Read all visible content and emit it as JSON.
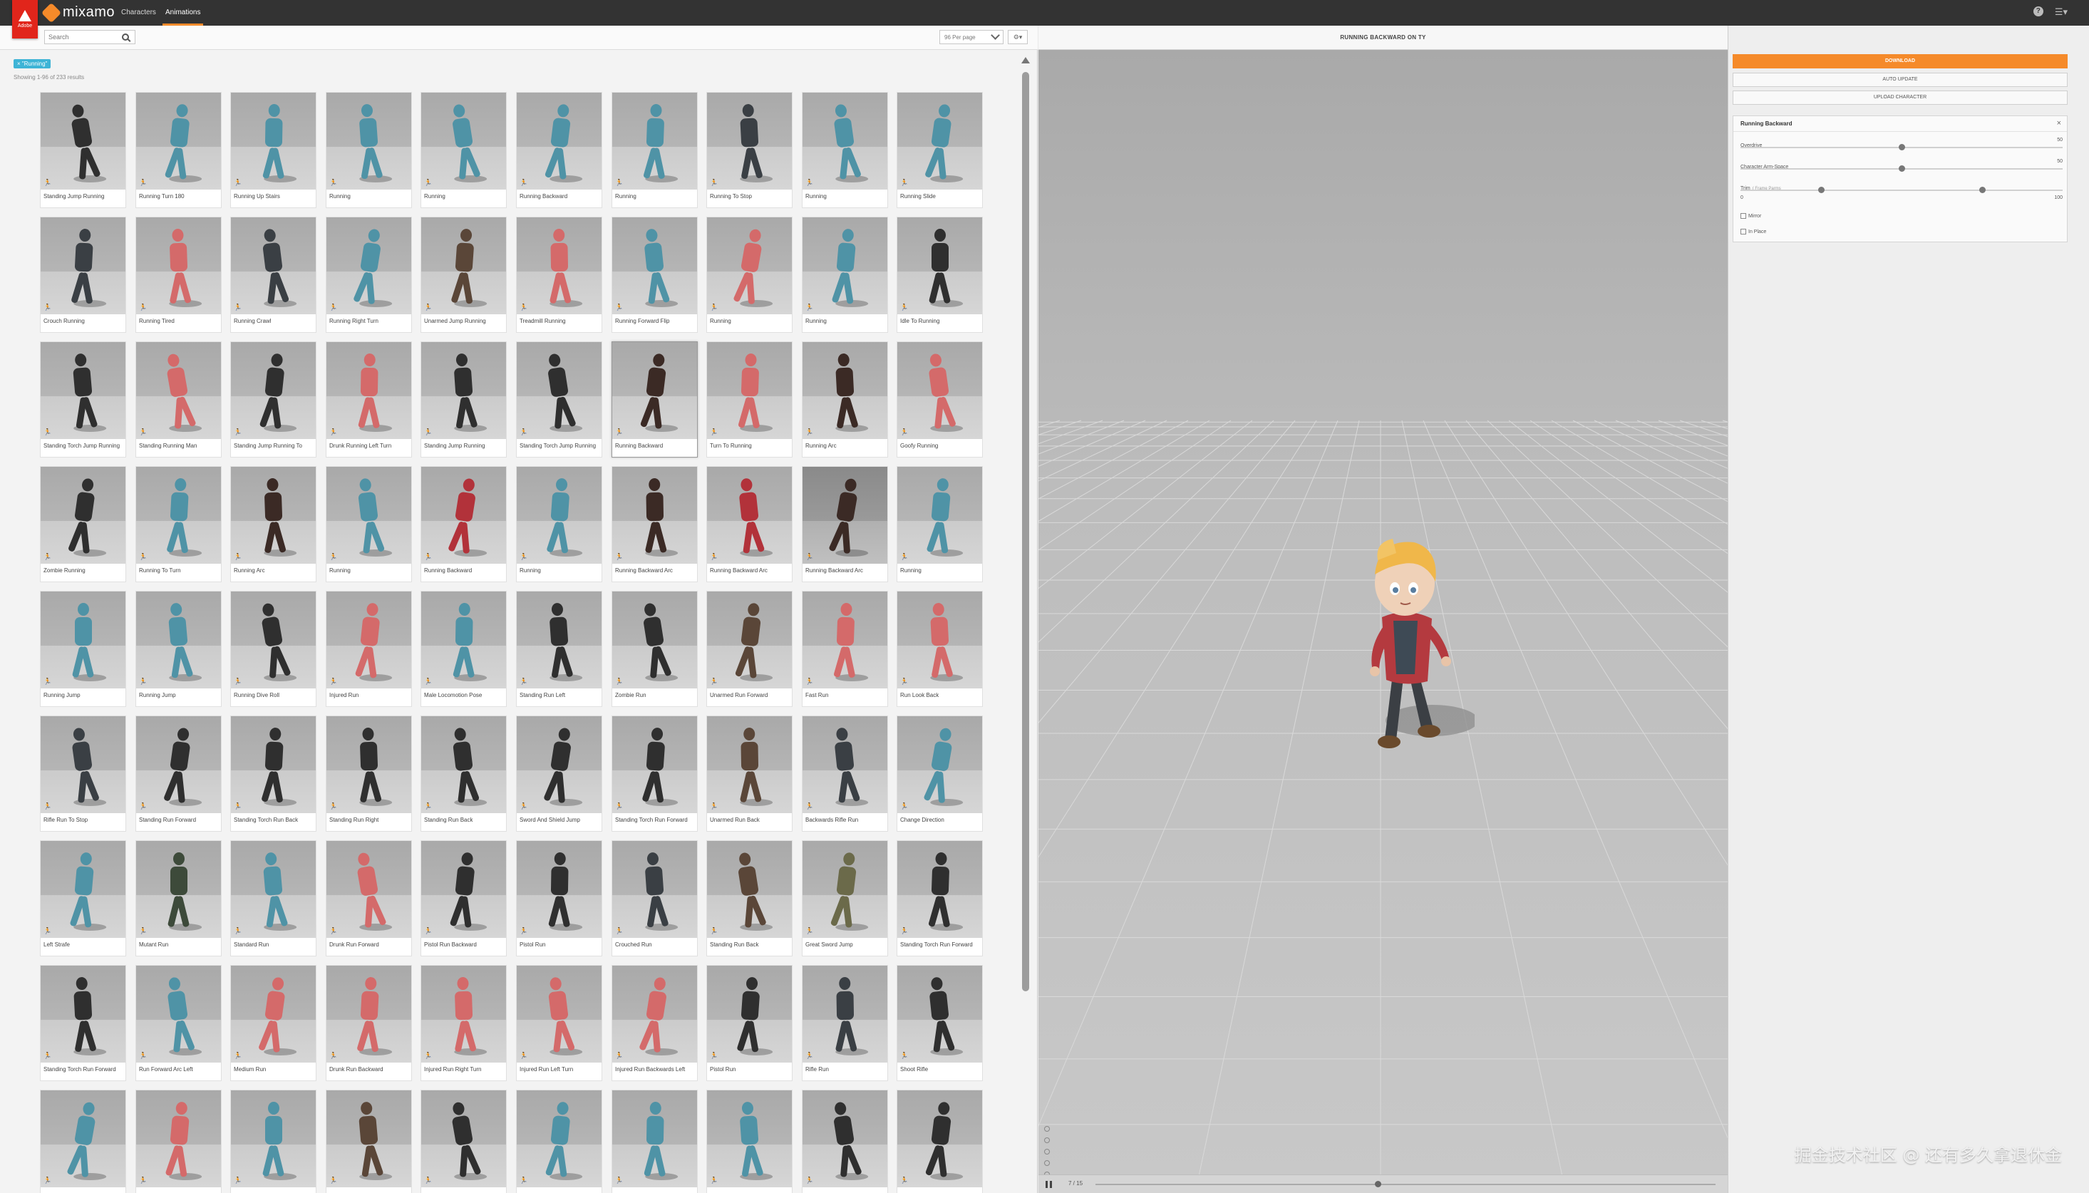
{
  "topbar": {
    "brand": "mixamo",
    "adobe_text": "Adobe",
    "tabs": [
      {
        "label": "Characters",
        "active": false
      },
      {
        "label": "Animations",
        "active": true
      }
    ],
    "help_glyph": "?",
    "menu_glyph": "☰▾"
  },
  "toolbar": {
    "search_placeholder": "Search",
    "per_page": "96 Per page",
    "settings_glyph": "⚙▾"
  },
  "filter_tag": "× \"Running\"",
  "results_count": "Showing 1-96 of 233 results",
  "run_glyph": "🏃",
  "animations": [
    {
      "label": "Standing Jump Running",
      "color": "#2f2f2f"
    },
    {
      "label": "Running Turn 180",
      "color": "#4f93a6"
    },
    {
      "label": "Running Up Stairs",
      "color": "#4f93a6"
    },
    {
      "label": "Running",
      "color": "#4f93a6"
    },
    {
      "label": "Running",
      "color": "#4f93a6"
    },
    {
      "label": "Running Backward",
      "color": "#4f93a6"
    },
    {
      "label": "Running",
      "color": "#4f93a6"
    },
    {
      "label": "Running To Stop",
      "color": "#3a3f44"
    },
    {
      "label": "Running",
      "color": "#4f93a6"
    },
    {
      "label": "Running Slide",
      "color": "#4f93a6"
    },
    {
      "label": "Crouch Running",
      "color": "#3a3f44"
    },
    {
      "label": "Running Tired",
      "color": "#d46a6a"
    },
    {
      "label": "Running Crawl",
      "color": "#3a3f44"
    },
    {
      "label": "Running Right Turn",
      "color": "#4f93a6"
    },
    {
      "label": "Unarmed Jump Running",
      "color": "#5a4638"
    },
    {
      "label": "Treadmill Running",
      "color": "#d46a6a"
    },
    {
      "label": "Running Forward Flip",
      "color": "#4f93a6"
    },
    {
      "label": "Running",
      "color": "#d46a6a"
    },
    {
      "label": "Running",
      "color": "#4f93a6"
    },
    {
      "label": "Idle To Running",
      "color": "#2f2f2f"
    },
    {
      "label": "Standing Torch Jump Running",
      "color": "#2f2f2f"
    },
    {
      "label": "Standing Running Man",
      "color": "#d46a6a"
    },
    {
      "label": "Standing Jump Running To",
      "color": "#2f2f2f"
    },
    {
      "label": "Drunk Running Left Turn",
      "color": "#d46a6a"
    },
    {
      "label": "Standing Jump Running",
      "color": "#2f2f2f"
    },
    {
      "label": "Standing Torch Jump Running",
      "color": "#2f2f2f"
    },
    {
      "label": "Running Backward",
      "color": "#3b2a25",
      "selected": true
    },
    {
      "label": "Turn To Running",
      "color": "#d46a6a"
    },
    {
      "label": "Running Arc",
      "color": "#3b2a25"
    },
    {
      "label": "Goofy Running",
      "color": "#d46a6a"
    },
    {
      "label": "Zombie Running",
      "color": "#2f2f2f"
    },
    {
      "label": "Running To Turn",
      "color": "#4f93a6"
    },
    {
      "label": "Running Arc",
      "color": "#3b2a25"
    },
    {
      "label": "Running",
      "color": "#4f93a6"
    },
    {
      "label": "Running Backward",
      "color": "#b2323a"
    },
    {
      "label": "Running",
      "color": "#4f93a6"
    },
    {
      "label": "Running Backward Arc",
      "color": "#3b2a25"
    },
    {
      "label": "Running Backward Arc",
      "color": "#b2323a"
    },
    {
      "label": "Running Backward Arc",
      "color": "#3b2a25",
      "dark": true
    },
    {
      "label": "Running",
      "color": "#4f93a6"
    },
    {
      "label": "Running Jump",
      "color": "#4f93a6"
    },
    {
      "label": "Running Jump",
      "color": "#4f93a6"
    },
    {
      "label": "Running Dive Roll",
      "color": "#2f2f2f"
    },
    {
      "label": "Injured Run",
      "color": "#d46a6a"
    },
    {
      "label": "Male Locomotion Pose",
      "color": "#4f93a6"
    },
    {
      "label": "Standing Run Left",
      "color": "#2f2f2f"
    },
    {
      "label": "Zombie Run",
      "color": "#2f2f2f"
    },
    {
      "label": "Unarmed Run Forward",
      "color": "#5a4638"
    },
    {
      "label": "Fast Run",
      "color": "#d46a6a"
    },
    {
      "label": "Run Look Back",
      "color": "#d46a6a"
    },
    {
      "label": "Rifle Run To Stop",
      "color": "#3a3f44"
    },
    {
      "label": "Standing Run Forward",
      "color": "#2f2f2f"
    },
    {
      "label": "Standing Torch Run Back",
      "color": "#2f2f2f"
    },
    {
      "label": "Standing Run Right",
      "color": "#2f2f2f"
    },
    {
      "label": "Standing Run Back",
      "color": "#2f2f2f"
    },
    {
      "label": "Sword And Shield Jump",
      "color": "#2f2f2f"
    },
    {
      "label": "Standing Torch Run Forward",
      "color": "#2f2f2f"
    },
    {
      "label": "Unarmed Run Back",
      "color": "#5a4638"
    },
    {
      "label": "Backwards Rifle Run",
      "color": "#3a3f44"
    },
    {
      "label": "Change Direction",
      "color": "#4f93a6"
    },
    {
      "label": "Left Strafe",
      "color": "#4f93a6"
    },
    {
      "label": "Mutant Run",
      "color": "#3d4a3a"
    },
    {
      "label": "Standard Run",
      "color": "#4f93a6"
    },
    {
      "label": "Drunk Run Forward",
      "color": "#d46a6a"
    },
    {
      "label": "Pistol Run Backward",
      "color": "#2f2f2f"
    },
    {
      "label": "Pistol Run",
      "color": "#2f2f2f"
    },
    {
      "label": "Crouched Run",
      "color": "#3a3f44"
    },
    {
      "label": "Standing Run Back",
      "color": "#5a4638"
    },
    {
      "label": "Great Sword Jump",
      "color": "#6b6a4a"
    },
    {
      "label": "Standing Torch Run Forward",
      "color": "#2f2f2f"
    },
    {
      "label": "Standing Torch Run Forward",
      "color": "#2f2f2f"
    },
    {
      "label": "Run Forward Arc Left",
      "color": "#4f93a6"
    },
    {
      "label": "Medium Run",
      "color": "#d46a6a"
    },
    {
      "label": "Drunk Run Backward",
      "color": "#d46a6a"
    },
    {
      "label": "Injured Run Right Turn",
      "color": "#d46a6a"
    },
    {
      "label": "Injured Run Left Turn",
      "color": "#d46a6a"
    },
    {
      "label": "Injured Run Backwards Left",
      "color": "#d46a6a"
    },
    {
      "label": "Pistol Run",
      "color": "#2f2f2f"
    },
    {
      "label": "Rifle Run",
      "color": "#3a3f44"
    },
    {
      "label": "Shoot Rifle",
      "color": "#2f2f2f"
    },
    {
      "label": "",
      "color": "#4f93a6"
    },
    {
      "label": "",
      "color": "#d46a6a"
    },
    {
      "label": "",
      "color": "#4f93a6"
    },
    {
      "label": "",
      "color": "#5a4638"
    },
    {
      "label": "",
      "color": "#2f2f2f"
    },
    {
      "label": "",
      "color": "#4f93a6"
    },
    {
      "label": "",
      "color": "#4f93a6"
    },
    {
      "label": "",
      "color": "#4f93a6"
    },
    {
      "label": "",
      "color": "#2f2f2f"
    },
    {
      "label": "",
      "color": "#2f2f2f"
    }
  ],
  "viewport": {
    "title": "RUNNING BACKWARD ON TY",
    "frame": "7 / 15",
    "progress": 0.45
  },
  "panel": {
    "download": "DOWNLOAD",
    "auto_update": "AUTO UPDATE",
    "upload_character": "UPLOAD CHARACTER",
    "card_title": "Running Backward",
    "close_glyph": "×",
    "params": [
      {
        "label": "Overdrive",
        "sub": "",
        "value": "50",
        "position": 0.5
      },
      {
        "label": "Character Arm-Space",
        "sub": "",
        "value": "50",
        "position": 0.5
      }
    ],
    "trim": {
      "label": "Trim",
      "sub": "( Frame Parms",
      "min": "0",
      "max": "100",
      "low": 0.25,
      "high": 0.75
    },
    "checkboxes": [
      {
        "label": "Mirror",
        "checked": false
      },
      {
        "label": "In Place",
        "checked": false
      }
    ]
  },
  "watermark": "掘金技术社区 @ 还有多久拿退休金",
  "colors": {
    "accent": "#f58a2a",
    "adobe_red": "#e1251b",
    "filter_blue": "#3eb4d6"
  }
}
